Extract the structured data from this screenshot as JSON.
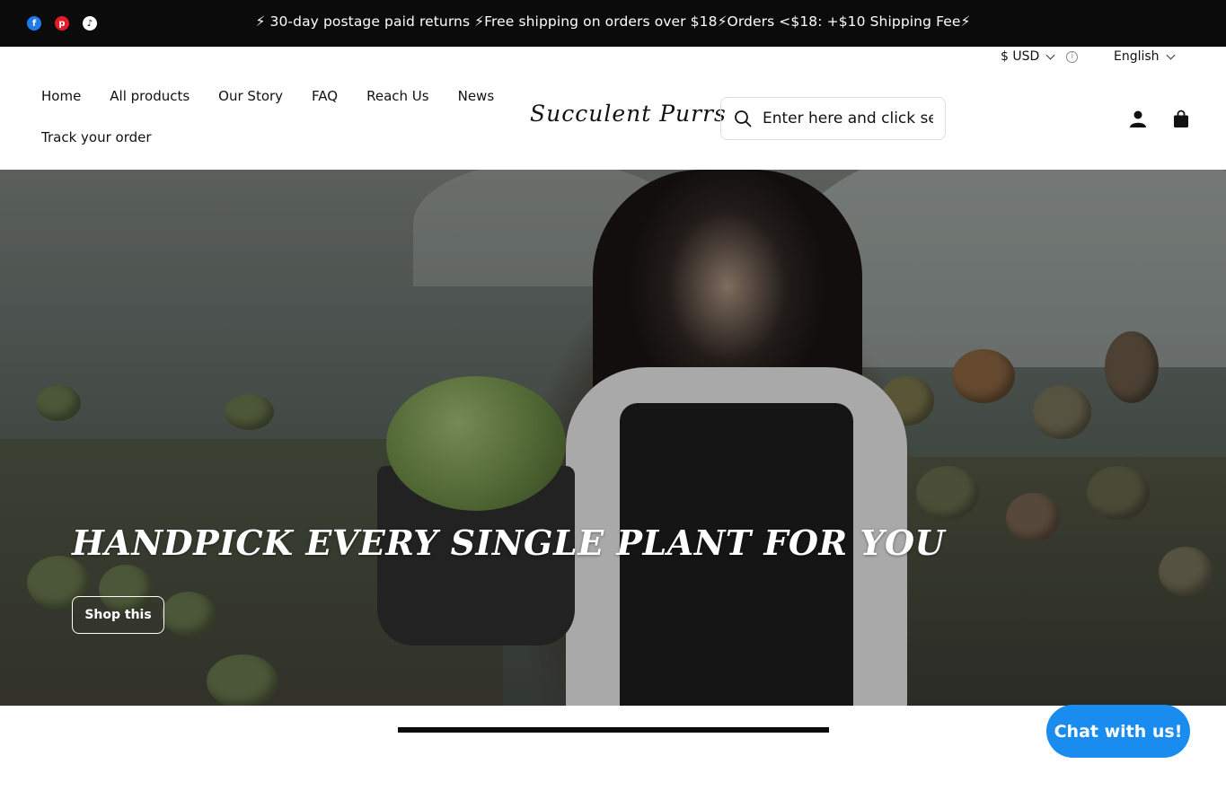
{
  "announcement": {
    "text": "⚡ 30-day postage paid returns ⚡Free shipping on orders over $18⚡Orders <$18: +$10 Shipping Fee⚡",
    "social_icons": [
      "facebook-icon",
      "pinterest-icon",
      "tiktok-icon"
    ]
  },
  "header": {
    "currency": "$ USD",
    "language": "English",
    "logo": "Succulent Purrs",
    "search_placeholder": "Enter here and click search",
    "nav": [
      "Home",
      "All products",
      "Our Story",
      "FAQ",
      "Reach Us",
      "News",
      "Track your order"
    ]
  },
  "hero": {
    "title": "HANDPICK EVERY SINGLE PLANT FOR YOU",
    "button": "Shop this"
  },
  "chat": {
    "label": "Chat with us!"
  },
  "colors": {
    "topbar": "#0b0b0b",
    "chat": "#1a8cf0",
    "facebook": "#1f7be8",
    "pinterest": "#e11d2a"
  }
}
